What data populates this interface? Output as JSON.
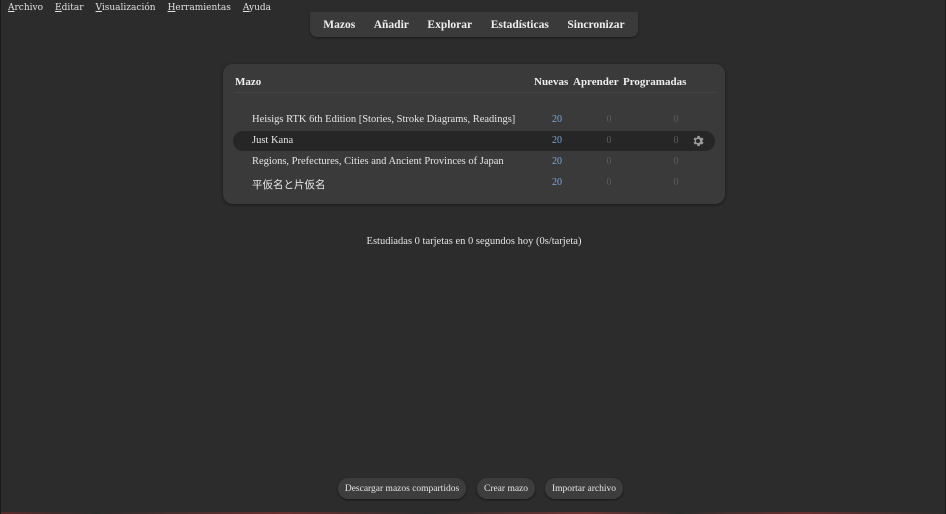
{
  "menubar": {
    "items": [
      {
        "first": "A",
        "rest": "rchivo"
      },
      {
        "first": "E",
        "rest": "ditar"
      },
      {
        "first": "V",
        "rest": "isualización"
      },
      {
        "first": "H",
        "rest": "erramientas"
      },
      {
        "first": "A",
        "rest": "yuda"
      }
    ]
  },
  "toolbar": {
    "decks": "Mazos",
    "add": "Añadir",
    "browse": "Explorar",
    "stats": "Estadísticas",
    "sync": "Sincronizar"
  },
  "deck_table": {
    "headers": {
      "deck": "Mazo",
      "new": "Nuevas",
      "learn": "Aprender",
      "due": "Programadas"
    },
    "rows": [
      {
        "name": "Heisigs RTK 6th Edition [Stories, Stroke Diagrams, Readings]",
        "new": "20",
        "learn": "0",
        "due": "0"
      },
      {
        "name": "Just Kana",
        "new": "20",
        "learn": "0",
        "due": "0"
      },
      {
        "name": "Regions, Prefectures, Cities and Ancient Provinces of Japan",
        "new": "20",
        "learn": "0",
        "due": "0"
      },
      {
        "name": "平仮名と片仮名",
        "new": "20",
        "learn": "0",
        "due": "0"
      }
    ],
    "current_row_index": 1
  },
  "stats_text": "Estudiadas 0 tarjetas en 0 segundos hoy (0s/tarjeta)",
  "bottom": {
    "shared": "Descargar mazos compartidos",
    "create": "Crear mazo",
    "import": "Importar archivo"
  },
  "icons": {
    "deck_options": "gear-icon"
  },
  "colors": {
    "background": "#2c2c2c",
    "panel": "#3a3a3a",
    "new_count": "#7aa8e0",
    "zero_count": "#5c5c5c"
  }
}
